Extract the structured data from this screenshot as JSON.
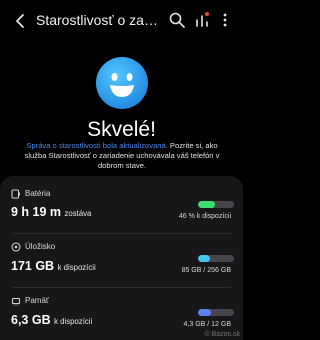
{
  "header": {
    "title": "Starostlivosť o zariadenie",
    "icons": [
      "back-arrow-icon",
      "search-icon",
      "bar-chart-icon",
      "more-vert-icon"
    ]
  },
  "status": {
    "headline": "Skvelé!",
    "link_text": "Správa o starostlivosti bola aktualizovaná.",
    "message": " Pozrite si, ako služba Starostlivosť o zariadenie uchovávala váš telefón v dobrom stave."
  },
  "battery": {
    "label": "Batéria",
    "value": "9 h 19 m",
    "unit": "zostáva",
    "bar_text": "46 % k dispozícii",
    "fill_fraction": 0.46,
    "color": "#3ddc6f"
  },
  "storage": {
    "label": "Úložisko",
    "value": "171 GB",
    "unit": "k dispozícii",
    "bar_text": "85 GB / 256 GB",
    "fill_fraction": 0.33,
    "color": "#49c6f0"
  },
  "memory": {
    "label": "Pamäť",
    "value": "6,3 GB",
    "unit": "k dispozícii",
    "bar_text": "4,3 GB / 12 GB",
    "fill_fraction": 0.36,
    "color": "#5a82f0"
  },
  "watermark": "© Bazos.sk"
}
